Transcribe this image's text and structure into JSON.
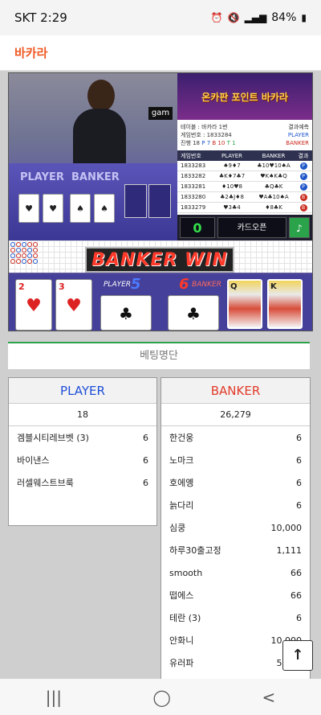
{
  "status": {
    "carrier_time": "SKT 2:29",
    "battery": "84%",
    "icons": [
      "alarm-icon",
      "mute-icon",
      "5g-icon",
      "signal-icon",
      "battery-icon"
    ]
  },
  "app": {
    "title": "바카라"
  },
  "game": {
    "video": {
      "watermark": "gam",
      "player_label": "PLAYER",
      "banker_label": "BANKER"
    },
    "panel": {
      "logo_text": "온카판 포인트 바카라",
      "table_label": "테이블 : 바카라 1번",
      "result_predict_label": "결과예측",
      "round_label": "게임번호 : 1833284",
      "progress_label": "진행 18",
      "progress_p": "P 7",
      "progress_b": "B 10",
      "progress_t": "T 1",
      "predict_player": "PLAYER",
      "predict_banker": "BANKER",
      "history_headers": [
        "게임번호",
        "PLAYER",
        "BANKER",
        "결과"
      ],
      "history": [
        {
          "round": "1833283",
          "player": "♠9♦7",
          "banker": "♣10♥10♠A",
          "result": "P"
        },
        {
          "round": "1833282",
          "player": "♣K♦7♣7",
          "banker": "♥K♠K♣Q",
          "result": "P"
        },
        {
          "round": "1833281",
          "player": "♦10♥8",
          "banker": "♣Q♣K",
          "result": "P"
        },
        {
          "round": "1833280",
          "player": "♣2♣J♦8",
          "banker": "♥A♣10♠A",
          "result": "B"
        },
        {
          "round": "1833279",
          "player": "♥3♣4",
          "banker": "♦8♣K",
          "result": "B"
        }
      ],
      "counter": "0",
      "card_open_label": "카드오픈"
    },
    "win_text": "BANKER WIN",
    "result": {
      "player_label": "PLAYER",
      "player_score": "5",
      "banker_label": "BANKER",
      "banker_score": "6",
      "player_cards": [
        {
          "value": "2",
          "suit": "♥"
        },
        {
          "value": "3",
          "suit": "♥"
        }
      ],
      "player_third": "♣",
      "banker_third": "♣",
      "banker_cards": [
        {
          "value": "Q"
        },
        {
          "value": "K"
        }
      ]
    }
  },
  "bet_section": {
    "tab_label": "베팅명단",
    "player": {
      "header": "PLAYER",
      "total": "18",
      "rows": [
        {
          "name": "겜블시티레브벳 (3)",
          "amount": "6"
        },
        {
          "name": "바이낸스",
          "amount": "6"
        },
        {
          "name": "러셀웨스트브룩",
          "amount": "6"
        }
      ]
    },
    "banker": {
      "header": "BANKER",
      "total": "26,279",
      "rows": [
        {
          "name": "한건웅",
          "amount": "6"
        },
        {
          "name": "노마크",
          "amount": "6"
        },
        {
          "name": "호에옝",
          "amount": "6"
        },
        {
          "name": "늙다리",
          "amount": "6"
        },
        {
          "name": "심쿵",
          "amount": "10,000"
        },
        {
          "name": "하루30출고정",
          "amount": "1,111"
        },
        {
          "name": "smooth",
          "amount": "66"
        },
        {
          "name": "떱에스",
          "amount": "66"
        },
        {
          "name": "테란 (3)",
          "amount": "6"
        },
        {
          "name": "안화니",
          "amount": "10,000"
        },
        {
          "name": "유러파",
          "amount": "5,000"
        }
      ]
    }
  },
  "nav": {
    "recent": "|||",
    "home": "◯",
    "back": "<"
  },
  "scroll_top": "↑"
}
